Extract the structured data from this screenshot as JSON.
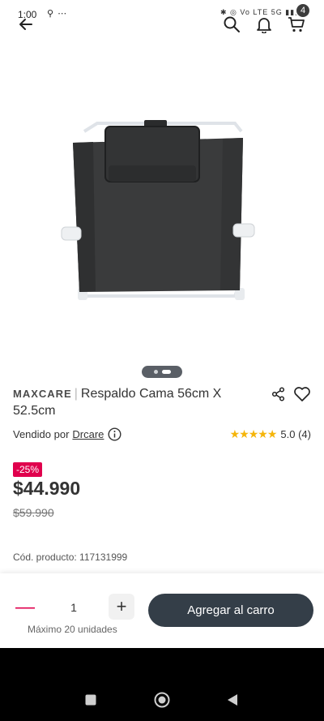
{
  "status_bar": {
    "time": "1:00",
    "extra": "⚲ ⋯",
    "system": "✱ ◎ Vo LTE 5G ▮▮▮ ▭"
  },
  "cart": {
    "count": "4"
  },
  "product": {
    "brand": "MAXCARE",
    "separator": "|",
    "name": "Respaldo Cama 56cm X 52.5cm",
    "sold_by_label": "Vendido por",
    "seller": "Drcare",
    "stars": "★★★★★",
    "rating": "5.0 (4)",
    "discount": "-25%",
    "price": "$44.990",
    "old_price": "$59.990",
    "sku": "Cód. producto: 117131999"
  },
  "purchase": {
    "minus_label": "—",
    "quantity": "1",
    "plus_label": "+",
    "max_label": "Máximo 20 unidades",
    "add_button": "Agregar al carro"
  },
  "colors": {
    "accent": "#e0004d",
    "button": "#343e48",
    "star": "#f5b50a"
  }
}
